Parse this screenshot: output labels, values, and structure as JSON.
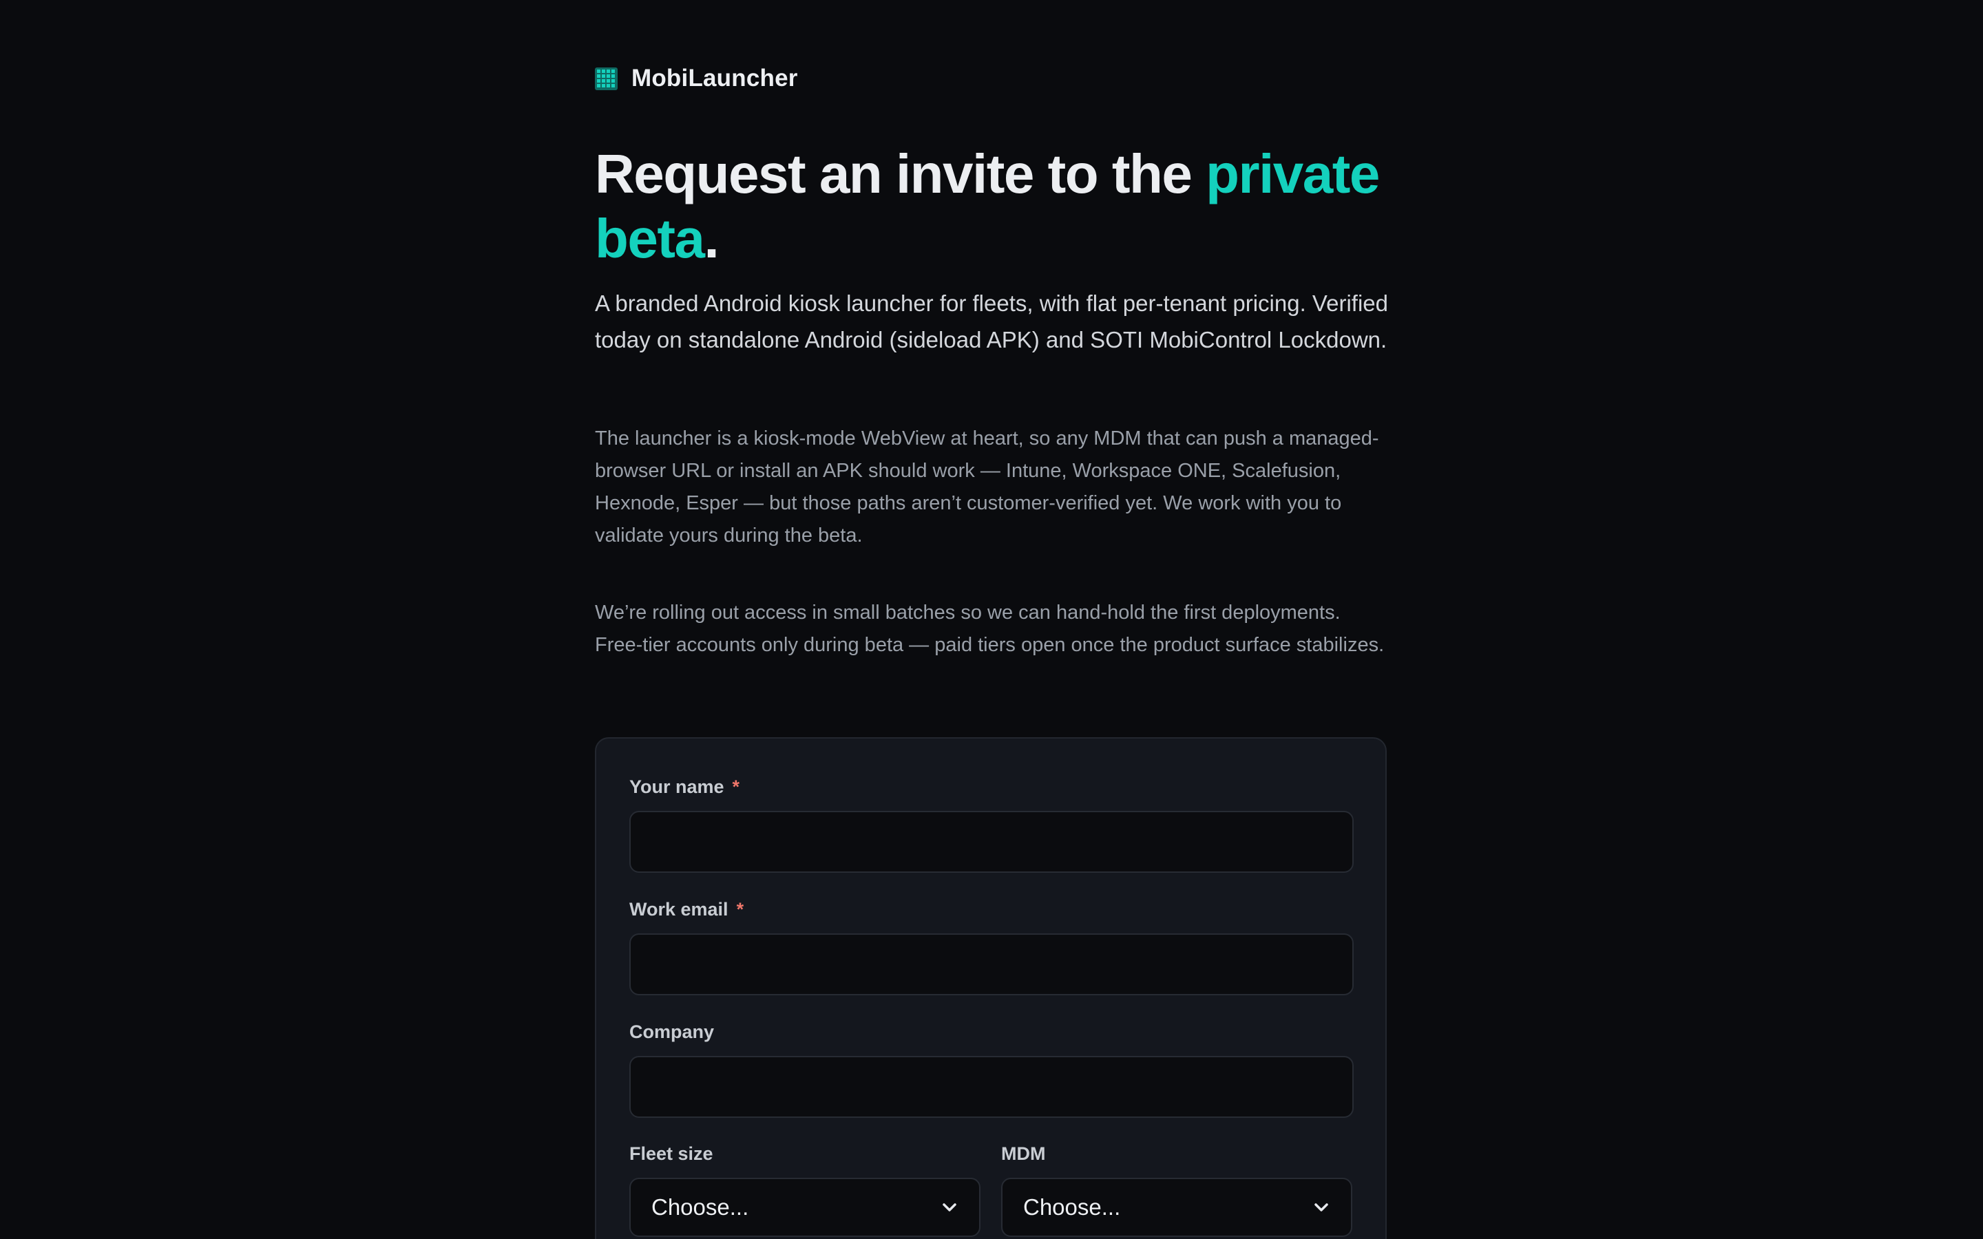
{
  "brand": {
    "name": "MobiLauncher",
    "icon": "grid-icon",
    "accent_color": "#14d1bd"
  },
  "hero": {
    "headline_prefix": "Request an invite to the ",
    "headline_accent": "private beta",
    "headline_suffix": ".",
    "lead": "A branded Android kiosk launcher for fleets, with flat per-tenant pricing. Verified today on standalone Android (sideload APK) and SOTI MobiControl Lockdown.",
    "paragraph_1": "The launcher is a kiosk-mode WebView at heart, so any MDM that can push a managed-browser URL or install an APK should work — Intune, Workspace ONE, Scalefusion, Hexnode, Esper — but those paths aren’t customer-verified yet. We work with you to validate yours during the beta.",
    "paragraph_2": "We’re rolling out access in small batches so we can hand-hold the first deployments. Free-tier accounts only during beta — paid tiers open once the product surface stabilizes."
  },
  "form": {
    "name_label": "Your name",
    "name_required": "*",
    "name_value": "",
    "email_label": "Work email",
    "email_required": "*",
    "email_value": "",
    "company_label": "Company",
    "company_value": "",
    "fleet_size_label": "Fleet size",
    "fleet_size_selected": "Choose...",
    "mdm_label": "MDM",
    "mdm_selected": "Choose..."
  }
}
